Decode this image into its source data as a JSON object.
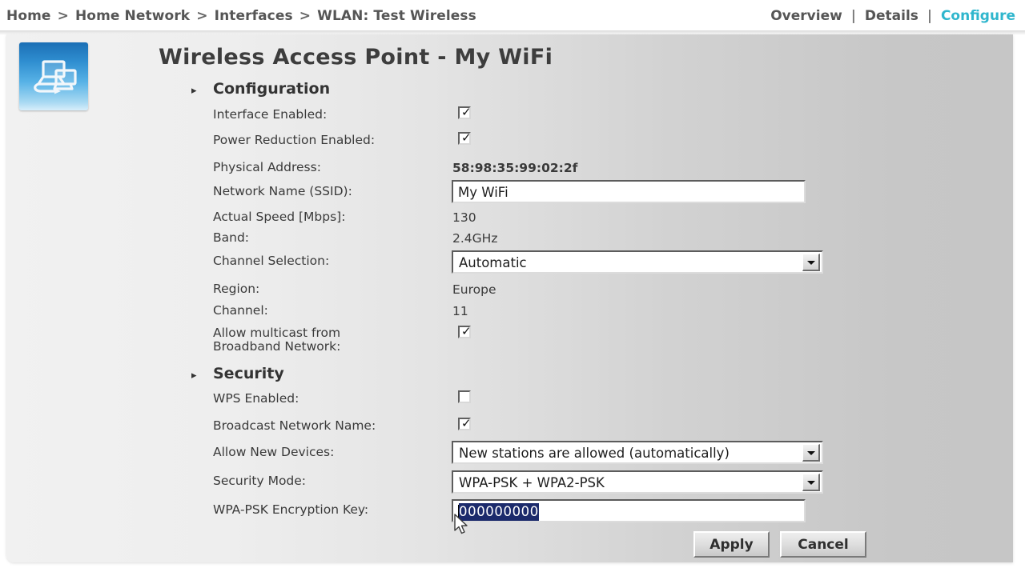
{
  "topbar": {
    "breadcrumb": {
      "icon": "breadcrumb-trail",
      "separator": ">",
      "items": [
        "Home",
        "Home Network",
        "Interfaces",
        "WLAN: Test Wireless"
      ]
    },
    "nav": {
      "separator": "|",
      "items": [
        {
          "label": "Overview",
          "active": false
        },
        {
          "label": "Details",
          "active": false
        },
        {
          "label": "Configure",
          "active": true
        }
      ],
      "active_color": "#2fb6cd"
    }
  },
  "page": {
    "icon": "wireless-access-point-icon",
    "title": "Wireless Access Point - My WiFi"
  },
  "sections": {
    "configuration": {
      "arrow": "▸",
      "title": "Configuration"
    },
    "security": {
      "arrow": "▸",
      "title": "Security"
    }
  },
  "fields": {
    "interface_enabled": {
      "label": "Interface Enabled:",
      "checked": true,
      "check": "✓"
    },
    "power_reduction_enabled": {
      "label": "Power Reduction Enabled:",
      "checked": true,
      "check": "✓"
    },
    "physical_address": {
      "label": "Physical Address:",
      "value": "58:98:35:99:02:2f"
    },
    "network_name_ssid": {
      "label": "Network Name (SSID):",
      "value": "My WiFi"
    },
    "actual_speed": {
      "label": "Actual Speed [Mbps]:",
      "value": "130"
    },
    "band": {
      "label": "Band:",
      "value": "2.4GHz"
    },
    "channel_selection": {
      "label": "Channel Selection:",
      "value": "Automatic"
    },
    "region": {
      "label": "Region:",
      "value": "Europe"
    },
    "channel": {
      "label": "Channel:",
      "value": "11"
    },
    "allow_multicast": {
      "label_line1": "Allow multicast from",
      "label_line2": "Broadband Network:",
      "checked": true,
      "check": "✓"
    },
    "wps_enabled": {
      "label": "WPS Enabled:",
      "checked": false,
      "check": ""
    },
    "broadcast_network_name": {
      "label": "Broadcast Network Name:",
      "checked": true,
      "check": "✓"
    },
    "allow_new_devices": {
      "label": "Allow New Devices:",
      "value": "New stations are allowed (automatically)"
    },
    "security_mode": {
      "label": "Security Mode:",
      "value": "WPA-PSK + WPA2-PSK"
    },
    "wpa_psk_key": {
      "label": "WPA-PSK Encryption Key:",
      "value": "000000000",
      "selected": true
    }
  },
  "buttons": {
    "apply": "Apply",
    "cancel": "Cancel"
  },
  "cursor": {
    "type": "arrow-pointer"
  }
}
